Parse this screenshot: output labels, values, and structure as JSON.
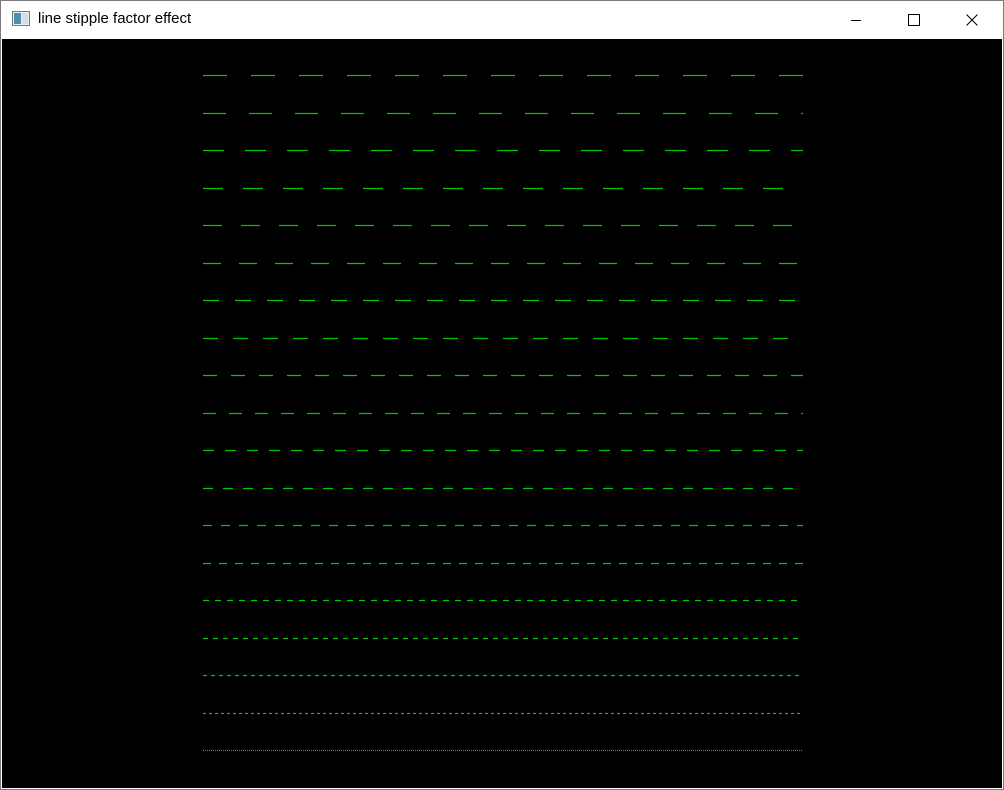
{
  "window": {
    "title": "line stipple factor effect"
  },
  "canvas": {
    "background": "#000000",
    "line_color": "#00c800",
    "pattern": "dashed",
    "line_count": 19,
    "stipple_factors": [
      19,
      18,
      17,
      16,
      15,
      14,
      13,
      12,
      11,
      10,
      9,
      8,
      7,
      6,
      5,
      4,
      3,
      2,
      1
    ]
  },
  "icons": {
    "app": "app-window-icon",
    "minimize": "minimize-icon",
    "maximize": "maximize-icon",
    "close": "close-icon"
  }
}
